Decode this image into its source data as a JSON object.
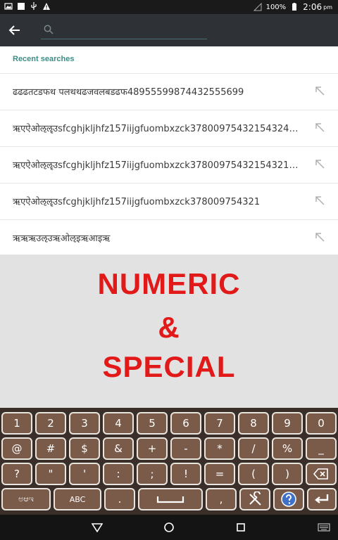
{
  "status_bar": {
    "battery": "100%",
    "time": "2:06",
    "ampm": "pm"
  },
  "search": {
    "placeholder": "",
    "value": ""
  },
  "recent": {
    "header": "Recent searches",
    "items": [
      "ढढढतटडफथ पलथथढजवलबडढफ48955599874432555699",
      "ऋएऐओऌॡउsfcghjkljhfz157iijgfuombxzck37800975432154324…",
      "ऋएऐओऌॡउsfcghjkljhfz157iijgfuombxzck37800975432154321…",
      "ऋएऐओऌॡउsfcghjkljhfz157iijgfuombxzck378009754321",
      "ऋऋऋउऌउऋओऌइऋआइऋ"
    ]
  },
  "promo": {
    "line1": "NUMERIC",
    "line2": "&",
    "line3": "SPECIAL"
  },
  "keyboard": {
    "row1": [
      "1",
      "2",
      "3",
      "4",
      "5",
      "6",
      "7",
      "8",
      "9",
      "0"
    ],
    "row2": [
      "@",
      "#",
      "$",
      "&",
      "+",
      "-",
      "*",
      "/",
      "%",
      "_"
    ],
    "row3": [
      "?",
      "\"",
      "'",
      ":",
      ";",
      "!",
      "=",
      "(",
      ")"
    ],
    "row4": {
      "lang": "ಅಆಇ",
      "abc": "ABC",
      "dot": ".",
      "comma": ","
    }
  },
  "colors": {
    "accent": "#3b8e85",
    "promo_text": "#e11919",
    "key_fill": "#7a5a48"
  }
}
